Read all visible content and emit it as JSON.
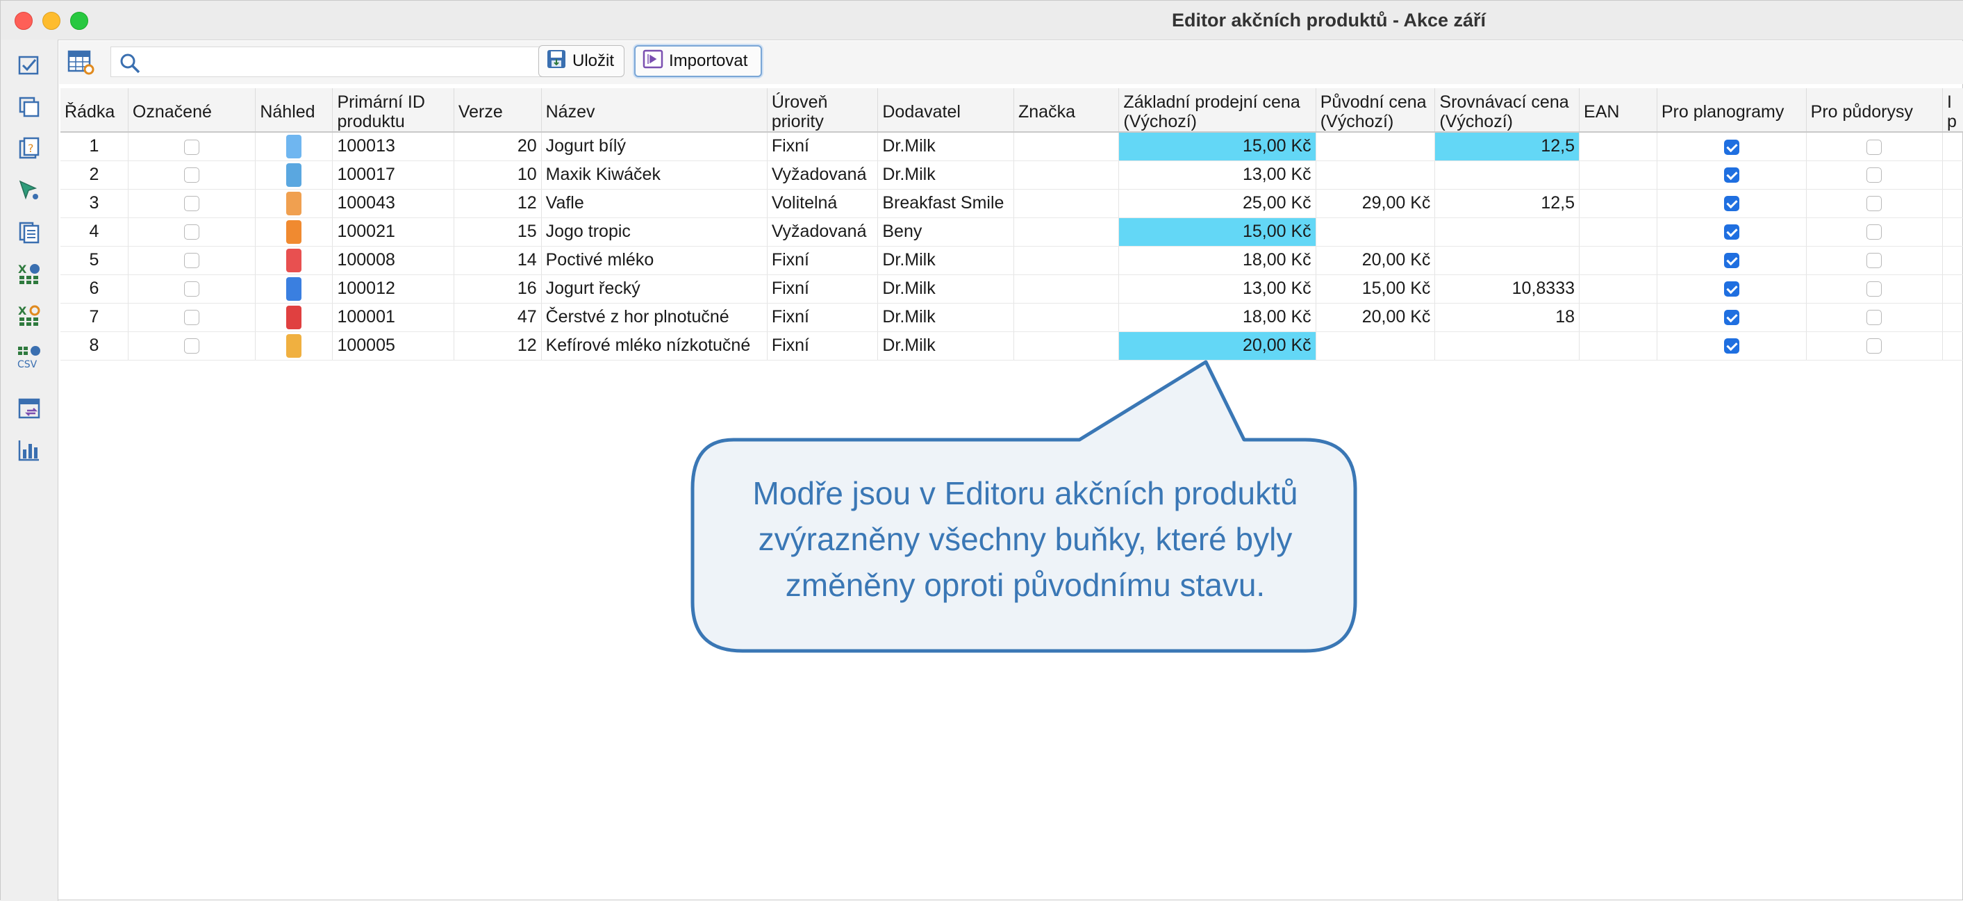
{
  "window": {
    "title": "Editor akčních produktů - Akce září"
  },
  "toolbar": {
    "search_placeholder": "",
    "save_label": "Uložit",
    "import_label": "Importovat"
  },
  "leftbar": {
    "icons": [
      "checklist-icon",
      "copy-icon",
      "help-list-icon",
      "cursor-select-icon",
      "document-list-icon",
      "excel-import-icon",
      "excel-settings-icon",
      "csv-import-icon",
      "table-transfer-icon",
      "bar-chart-icon"
    ]
  },
  "table": {
    "headers": {
      "radka": "Řádka",
      "oznacene": "Označené",
      "nahled": "Náhled",
      "primarni_id_1": "Primární ID",
      "primarni_id_2": "produktu",
      "verze": "Verze",
      "nazev": "Název",
      "uroven_1": "Úroveň",
      "uroven_2": "priority",
      "dodavatel": "Dodavatel",
      "znacka": "Značka",
      "zakladni_1": "Základní prodejní cena",
      "zakladni_2": "(Výchozí)",
      "puvodni_1": "Původní cena",
      "puvodni_2": "(Výchozí)",
      "srovnavaci_1": "Srovnávací cena",
      "srovnavaci_2": "(Výchozí)",
      "ean": "EAN",
      "pro_planogramy": "Pro planogramy",
      "pro_pudorysy": "Pro půdorysy",
      "next_1": "I",
      "next_2": "p"
    },
    "rows": [
      {
        "radka": "1",
        "id": "100013",
        "verze": "20",
        "nazev": "Jogurt bílý",
        "uroven": "Fixní",
        "dodavatel": "Dr.Milk",
        "znacka": "",
        "zakladni": "15,00 Kč",
        "puvodni": "",
        "srovnavaci": "12,5",
        "ean": "",
        "planogramy": true,
        "pudorysy": false
      },
      {
        "radka": "2",
        "id": "100017",
        "verze": "10",
        "nazev": "Maxik Kiwáček",
        "uroven": "Vyžadovaná",
        "dodavatel": "Dr.Milk",
        "znacka": "",
        "zakladni": "13,00 Kč",
        "puvodni": "",
        "srovnavaci": "",
        "ean": "",
        "planogramy": true,
        "pudorysy": false
      },
      {
        "radka": "3",
        "id": "100043",
        "verze": "12",
        "nazev": "Vafle",
        "uroven": "Volitelná",
        "dodavatel": "Breakfast Smile",
        "znacka": "",
        "zakladni": "25,00 Kč",
        "puvodni": "29,00 Kč",
        "srovnavaci": "12,5",
        "ean": "",
        "planogramy": true,
        "pudorysy": false
      },
      {
        "radka": "4",
        "id": "100021",
        "verze": "15",
        "nazev": "Jogo tropic",
        "uroven": "Vyžadovaná",
        "dodavatel": "Beny",
        "znacka": "",
        "zakladni": "15,00 Kč",
        "puvodni": "",
        "srovnavaci": "",
        "ean": "",
        "planogramy": true,
        "pudorysy": false
      },
      {
        "radka": "5",
        "id": "100008",
        "verze": "14",
        "nazev": "Poctivé mléko",
        "uroven": "Fixní",
        "dodavatel": "Dr.Milk",
        "znacka": "",
        "zakladni": "18,00 Kč",
        "puvodni": "20,00 Kč",
        "srovnavaci": "",
        "ean": "",
        "planogramy": true,
        "pudorysy": false
      },
      {
        "radka": "6",
        "id": "100012",
        "verze": "16",
        "nazev": "Jogurt řecký",
        "uroven": "Fixní",
        "dodavatel": "Dr.Milk",
        "znacka": "",
        "zakladni": "13,00 Kč",
        "puvodni": "15,00 Kč",
        "srovnavaci": "10,8333",
        "ean": "",
        "planogramy": true,
        "pudorysy": false
      },
      {
        "radka": "7",
        "id": "100001",
        "verze": "47",
        "nazev": "Čerstvé z hor plnotučné",
        "uroven": "Fixní",
        "dodavatel": "Dr.Milk",
        "znacka": "",
        "zakladni": "18,00 Kč",
        "puvodni": "20,00 Kč",
        "srovnavaci": "18",
        "ean": "",
        "planogramy": true,
        "pudorysy": false
      },
      {
        "radka": "8",
        "id": "100005",
        "verze": "12",
        "nazev": "Kefírové mléko nízkotučné",
        "uroven": "Fixní",
        "dodavatel": "Dr.Milk",
        "znacka": "",
        "zakladni": "20,00 Kč",
        "puvodni": "",
        "srovnavaci": "",
        "ean": "",
        "planogramy": true,
        "pudorysy": false
      }
    ],
    "highlight_color": "#63d7f6"
  },
  "callout": {
    "line1": "Modře jsou v Editoru akčních produktů",
    "line2": "zvýrazněny všechny buňky, které byly",
    "line3": "změněny oproti původnímu stavu.",
    "border_color": "#3a77b5",
    "fill_color": "#eef3f8"
  }
}
